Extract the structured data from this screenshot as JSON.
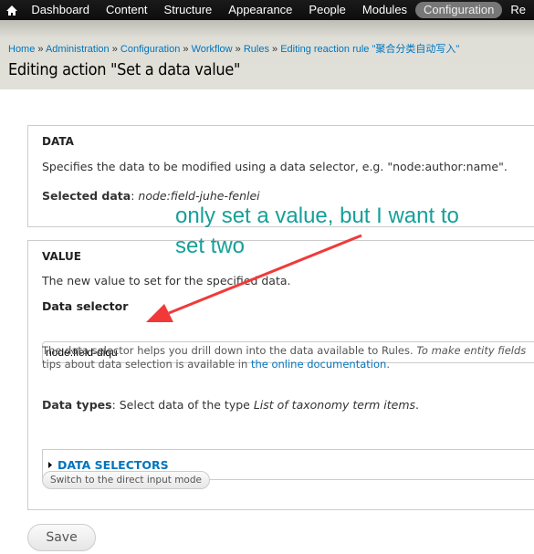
{
  "toolbar": {
    "items": [
      "Dashboard",
      "Content",
      "Structure",
      "Appearance",
      "People",
      "Modules",
      "Configuration",
      "Re"
    ],
    "active": "Configuration"
  },
  "breadcrumb": [
    "Home",
    "Administration",
    "Configuration",
    "Workflow",
    "Rules",
    "Editing reaction rule \"聚合分类自动写入\""
  ],
  "page_title": "Editing action \"Set a data value\"",
  "data_section": {
    "legend": "DATA",
    "description": "Specifies the data to be modified using a data selector, e.g. \"node:author:name\".",
    "selected_label": "Selected data",
    "selected_value": "node:field-juhe-fenlei"
  },
  "value_section": {
    "legend": "VALUE",
    "description": "The new value to set for the specified data.",
    "selector_label": "Data selector",
    "selector_value": "node:field-diqu",
    "help_1": "The data selector helps you drill down into the data available to Rules. ",
    "help_1_em": "To make entity fields",
    "help_2": "tips about data selection is available in ",
    "help_link": "the online documentation",
    "help_end": ".",
    "types_label": "Data types",
    "types_text": ": Select data of the type ",
    "types_em": "List of taxonomy term items",
    "types_end": ".",
    "selectors_label": "DATA SELECTORS",
    "switch_button": "Switch to the direct input mode"
  },
  "save_button": "Save",
  "annotation": {
    "line1": "only set a value, but I want to",
    "line2": "set two",
    "color": "#16a09a",
    "arrow_color": "#f03a3a"
  }
}
